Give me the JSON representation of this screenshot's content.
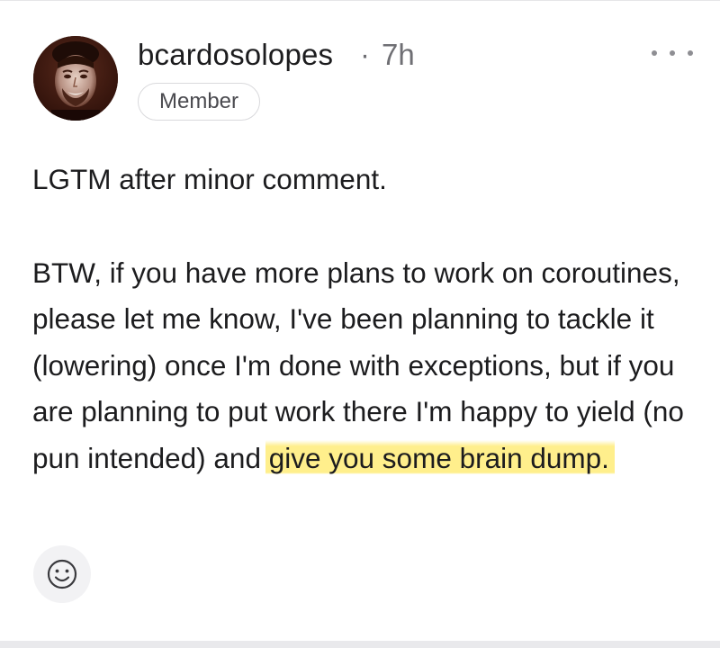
{
  "post": {
    "author": {
      "username": "bcardosolopes",
      "badge": "Member",
      "avatar_icon": "user-avatar-photo"
    },
    "separator": "·",
    "timestamp": "7h",
    "more_icon": "ellipsis-icon",
    "comment": {
      "paragraph_1": "LGTM after minor comment.",
      "paragraph_2_text": "BTW, if you have more plans to work on coroutines, please let me know, I've been planning to tackle it (lowering) once I'm done with exceptions, but if you are planning to put work there I'm happy to yield (no pun intended) and ",
      "paragraph_2_highlighted": "give you some brain dump."
    },
    "reaction_icon": "smiley-face-icon"
  },
  "colors": {
    "highlight": "#ffec78",
    "text": "#1c1c1e",
    "muted": "#6f6f74",
    "avatar_bg": "#3a1a12"
  }
}
